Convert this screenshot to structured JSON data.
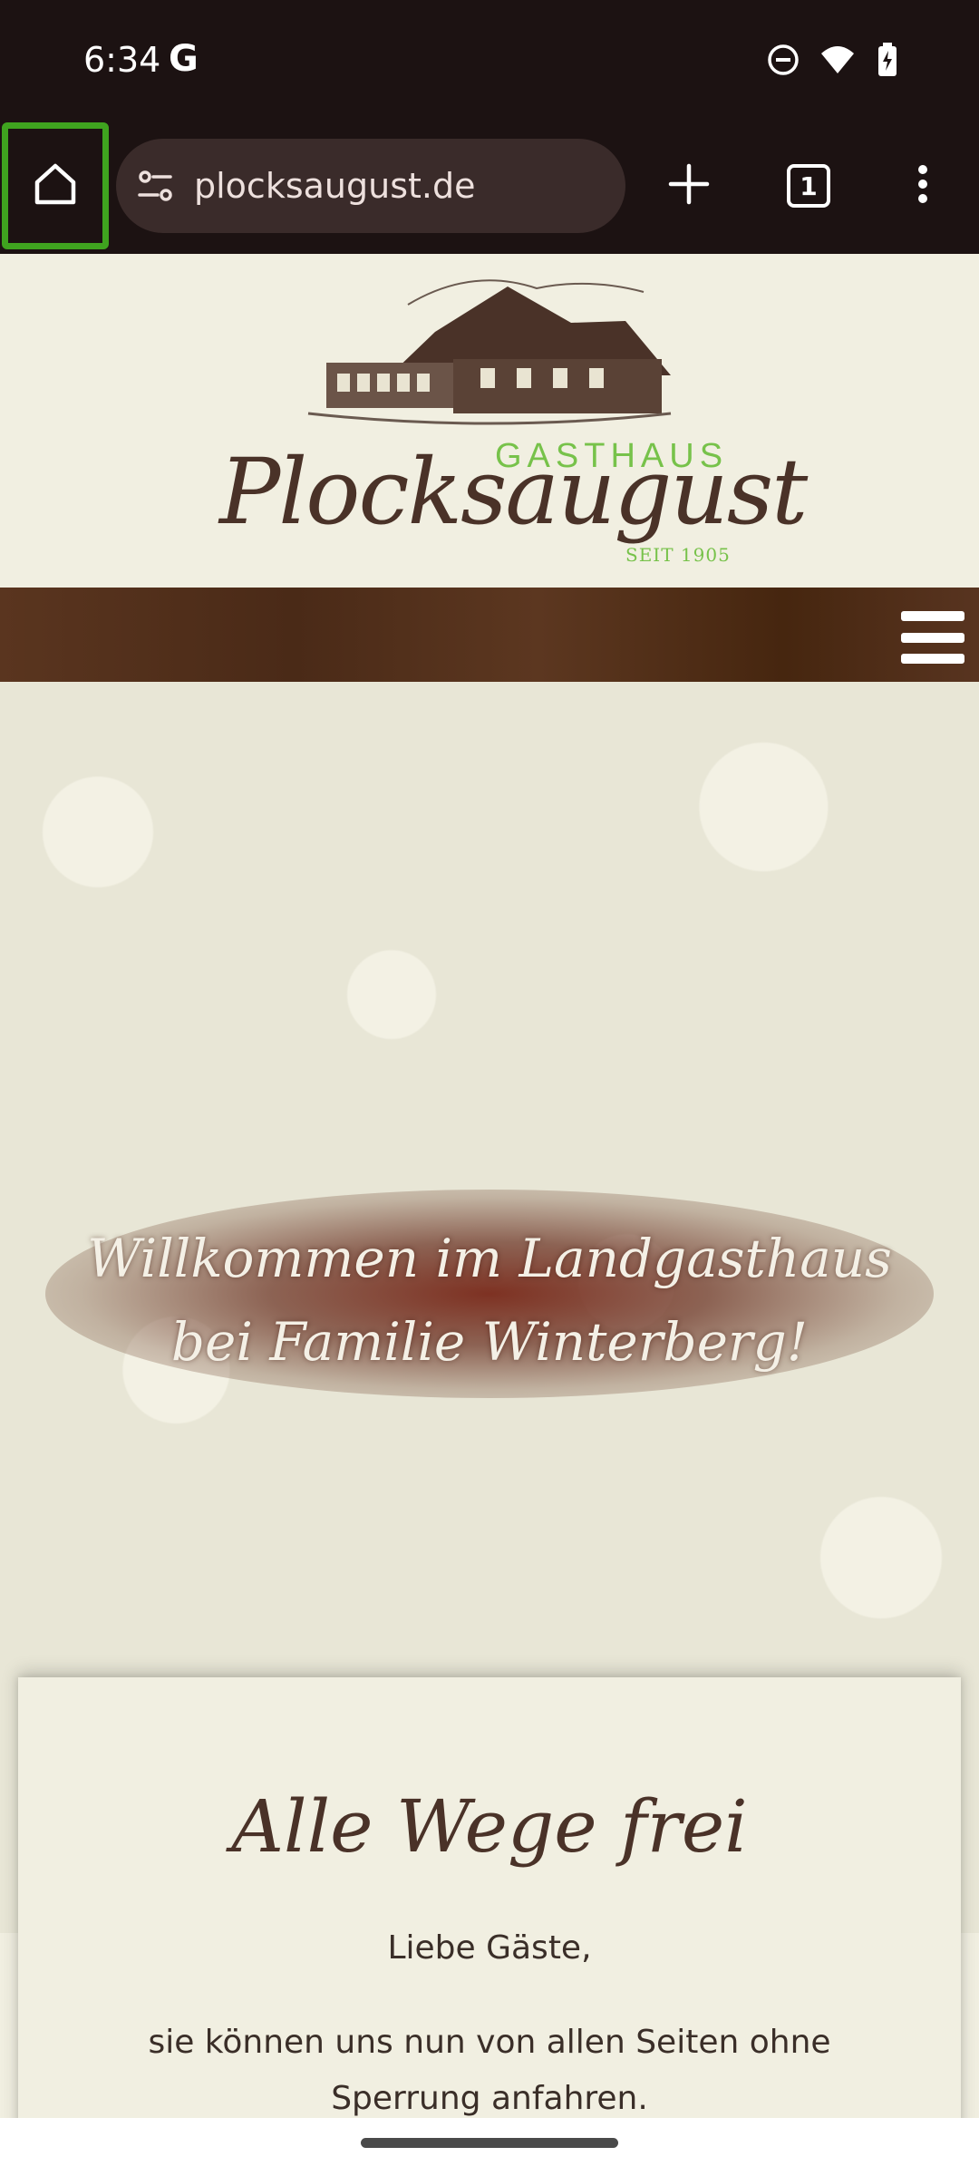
{
  "status_bar": {
    "time": "6:34",
    "google_glyph": "G",
    "icons": [
      "do-not-disturb-icon",
      "wifi-icon",
      "battery-icon"
    ]
  },
  "browser": {
    "url": "plocksaugust.de",
    "tab_count": "1",
    "home_highlight_color": "#3fa31f"
  },
  "site": {
    "logo": {
      "gasthaus": "GASTHAUS",
      "name": "Plocksaugust",
      "since": "SEIT 1905"
    },
    "hero": {
      "line1": "Willkommen im Landgasthaus",
      "line2": "bei Familie Winterberg!"
    },
    "notice": {
      "title": "Alle Wege frei",
      "greeting": "Liebe Gäste,",
      "body": "sie können uns nun von allen Seiten ohne Sperrung anfahren."
    },
    "colors": {
      "brand_brown": "#4a3228",
      "brand_green": "#77c24a",
      "nav_band": "#4a2a17",
      "background": "#f1efe1"
    }
  }
}
